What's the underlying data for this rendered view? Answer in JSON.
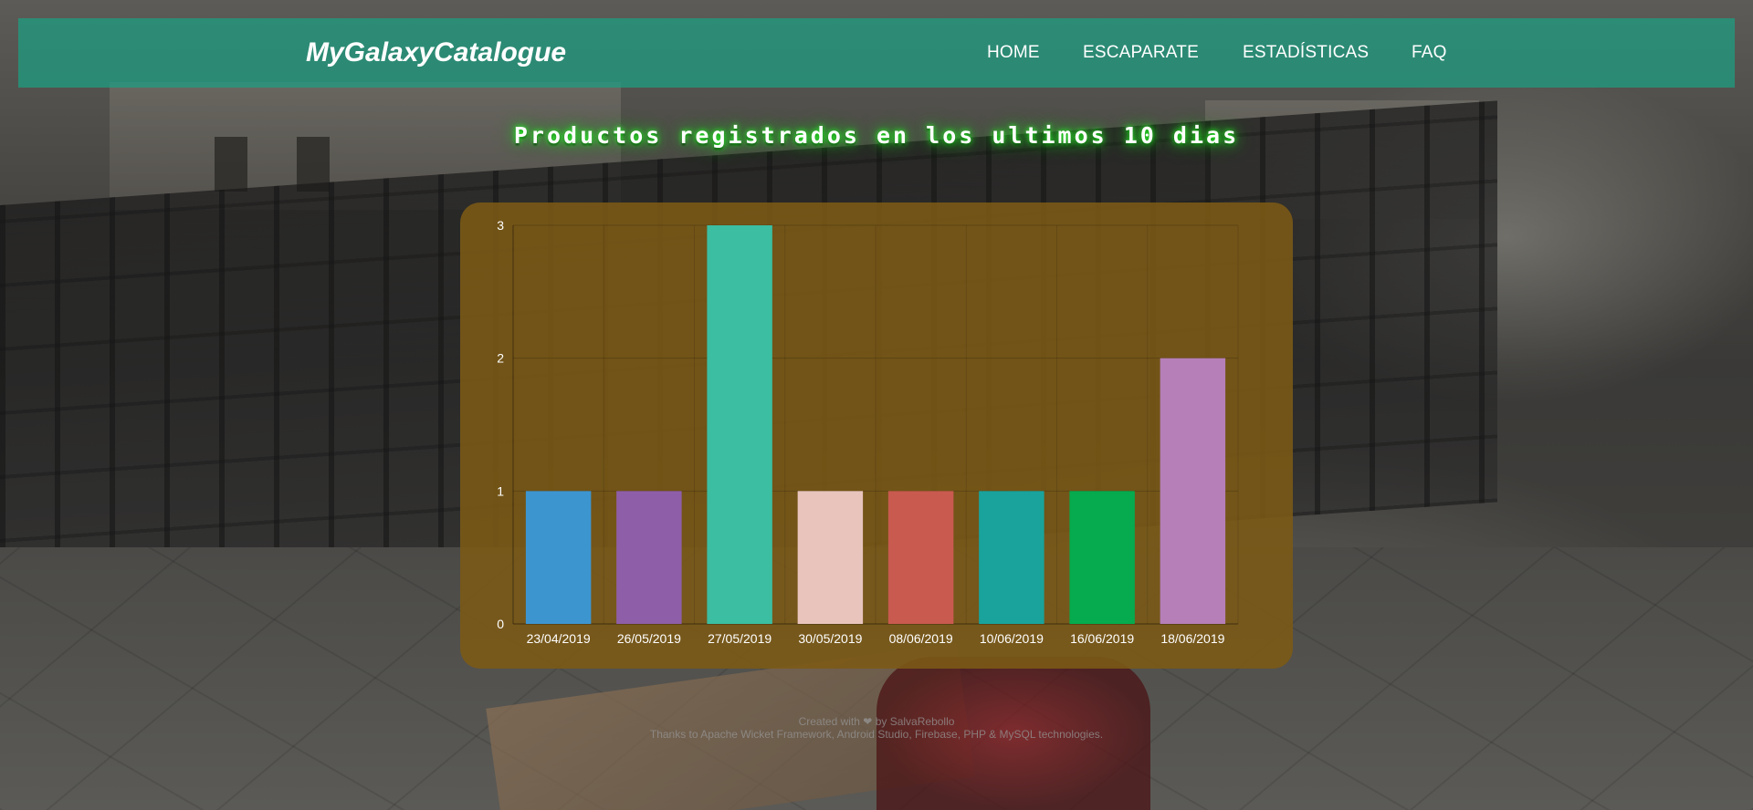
{
  "navbar": {
    "brand": "MyGalaxyCatalogue",
    "links": [
      {
        "label": "HOME"
      },
      {
        "label": "ESCAPARATE"
      },
      {
        "label": "ESTADÍSTICAS"
      },
      {
        "label": "FAQ"
      }
    ],
    "background_color": "#1ca082"
  },
  "page": {
    "title": "Productos registrados en los ultimos 10 dias"
  },
  "chart_data": {
    "type": "bar",
    "categories": [
      "23/04/2019",
      "26/05/2019",
      "27/05/2019",
      "30/05/2019",
      "08/06/2019",
      "10/06/2019",
      "16/06/2019",
      "18/06/2019"
    ],
    "values": [
      1,
      1,
      3,
      1,
      1,
      1,
      1,
      2
    ],
    "colors": [
      "#3d95d0",
      "#8e5ea8",
      "#3bbea2",
      "#e8c4bd",
      "#c95a50",
      "#19a39c",
      "#05ab4e",
      "#b67fb8"
    ],
    "ylim": [
      0,
      3
    ],
    "yticks": [
      "0",
      "1",
      "2",
      "3"
    ],
    "title": "",
    "xlabel": "",
    "ylabel": "",
    "grid": true,
    "legend": "none",
    "panel_color": "#7c5a16"
  },
  "footer": {
    "created_prefix": "Created with",
    "heart_icon": "heart-icon",
    "created_suffix": "by SalvaRebollo",
    "thanks": "Thanks to Apache Wicket Framework, Android Studio, Firebase, PHP & MySQL technologies."
  }
}
